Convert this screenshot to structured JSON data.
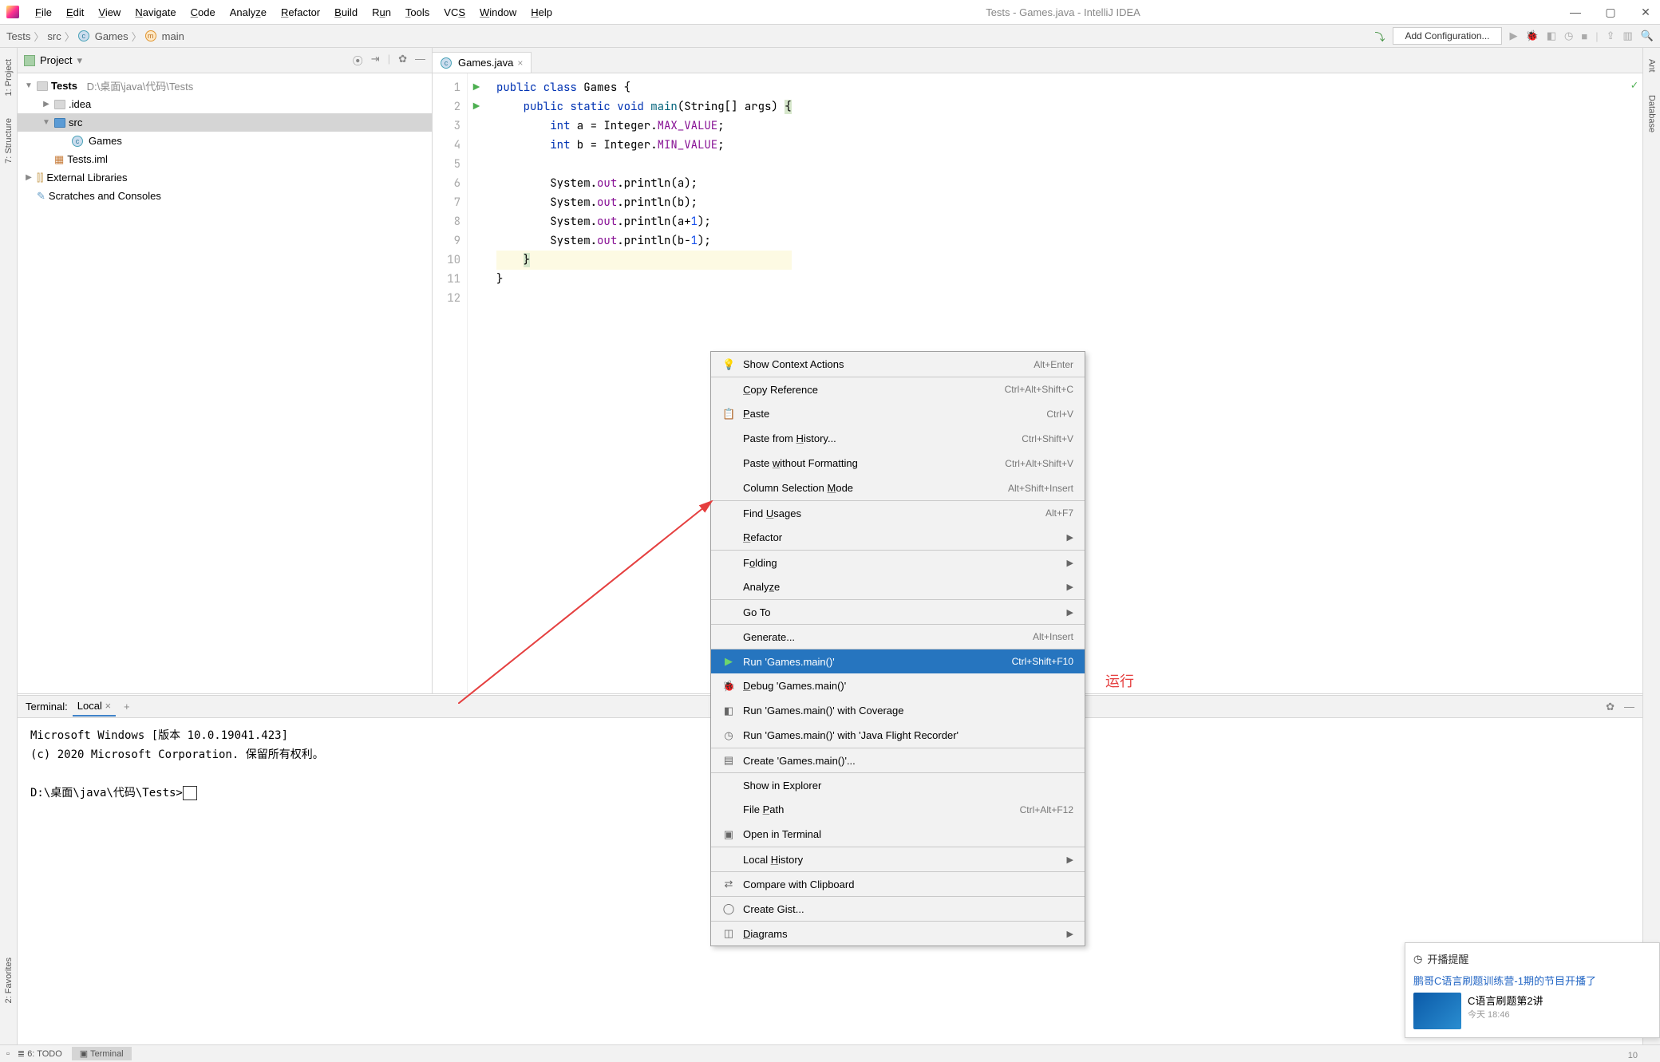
{
  "window": {
    "title": "Tests - Games.java - IntelliJ IDEA"
  },
  "menubar": {
    "items": [
      "File",
      "Edit",
      "View",
      "Navigate",
      "Code",
      "Analyze",
      "Refactor",
      "Build",
      "Run",
      "Tools",
      "VCS",
      "Window",
      "Help"
    ]
  },
  "breadcrumb": {
    "p1": "Tests",
    "p2": "src",
    "p3": "Games",
    "p4": "main"
  },
  "toolbar": {
    "config": "Add Configuration..."
  },
  "left_tabs": {
    "project": "1: Project",
    "structure": "7: Structure",
    "favorites": "2: Favorites"
  },
  "right_tabs": {
    "ant": "Ant",
    "database": "Database"
  },
  "project": {
    "title": "Project",
    "root": "Tests",
    "root_path": "D:\\桌面\\java\\代码\\Tests",
    "idea": ".idea",
    "src": "src",
    "games": "Games",
    "iml": "Tests.iml",
    "ext": "External Libraries",
    "scratch": "Scratches and Consoles"
  },
  "editor_tab": {
    "name": "Games.java"
  },
  "code": {
    "l1_a": "public class",
    "l1_b": "Games {",
    "l2_a": "public static void",
    "l2_b": "main",
    "l2_c": "(String[] args) ",
    "l2_d": "{",
    "l3_a": "int",
    "l3_b": " a = Integer.",
    "l3_c": "MAX_VALUE",
    "l3_d": ";",
    "l4_a": "int",
    "l4_b": " b = Integer.",
    "l4_c": "MIN_VALUE",
    "l4_d": ";",
    "l6": "System.",
    "l6b": "out",
    "l6c": ".println(a);",
    "l7": "System.",
    "l7b": "out",
    "l7c": ".println(b);",
    "l8": "System.",
    "l8b": "out",
    "l8c": ".println(a+",
    "l8d": "1",
    "l8e": ");",
    "l9": "System.",
    "l9b": "out",
    "l9c": ".println(b-",
    "l9d": "1",
    "l9e": ");",
    "l10": "}",
    "l11": "}"
  },
  "linenums": [
    "1",
    "2",
    "3",
    "4",
    "5",
    "6",
    "7",
    "8",
    "9",
    "10",
    "11",
    "12"
  ],
  "terminal": {
    "title": "Terminal:",
    "tab": "Local",
    "line1": "Microsoft Windows [版本 10.0.19041.423]",
    "line2": "(c) 2020 Microsoft Corporation. 保留所有权利。",
    "prompt": "D:\\桌面\\java\\代码\\Tests>"
  },
  "status": {
    "todo": "6: TODO",
    "terminal": "Terminal"
  },
  "rc": "10",
  "ctx": {
    "i1": {
      "l": "Show Context Actions",
      "s": "Alt+Enter"
    },
    "i2": {
      "l": "Copy Reference",
      "s": "Ctrl+Alt+Shift+C"
    },
    "i3": {
      "l": "Paste",
      "s": "Ctrl+V"
    },
    "i4": {
      "l": "Paste from History...",
      "s": "Ctrl+Shift+V"
    },
    "i5": {
      "l": "Paste without Formatting",
      "s": "Ctrl+Alt+Shift+V"
    },
    "i6": {
      "l": "Column Selection Mode",
      "s": "Alt+Shift+Insert"
    },
    "i7": {
      "l": "Find Usages",
      "s": "Alt+F7"
    },
    "i8": {
      "l": "Refactor"
    },
    "i9": {
      "l": "Folding"
    },
    "i10": {
      "l": "Analyze"
    },
    "i11": {
      "l": "Go To"
    },
    "i12": {
      "l": "Generate...",
      "s": "Alt+Insert"
    },
    "i13": {
      "l": "Run 'Games.main()'",
      "s": "Ctrl+Shift+F10"
    },
    "i14": {
      "l": "Debug 'Games.main()'"
    },
    "i15": {
      "l": "Run 'Games.main()' with Coverage"
    },
    "i16": {
      "l": "Run 'Games.main()' with 'Java Flight Recorder'"
    },
    "i17": {
      "l": "Create 'Games.main()'..."
    },
    "i18": {
      "l": "Show in Explorer"
    },
    "i19": {
      "l": "File Path",
      "s": "Ctrl+Alt+F12"
    },
    "i20": {
      "l": "Open in Terminal"
    },
    "i21": {
      "l": "Local History"
    },
    "i22": {
      "l": "Compare with Clipboard"
    },
    "i23": {
      "l": "Create Gist..."
    },
    "i24": {
      "l": "Diagrams"
    }
  },
  "annot": "运行",
  "popup": {
    "header": "开播提醒",
    "link": "鹏哥C语言刷题训练营-1期的节目开播了",
    "title": "C语言刷题第2讲",
    "time": "今天 18:46"
  }
}
